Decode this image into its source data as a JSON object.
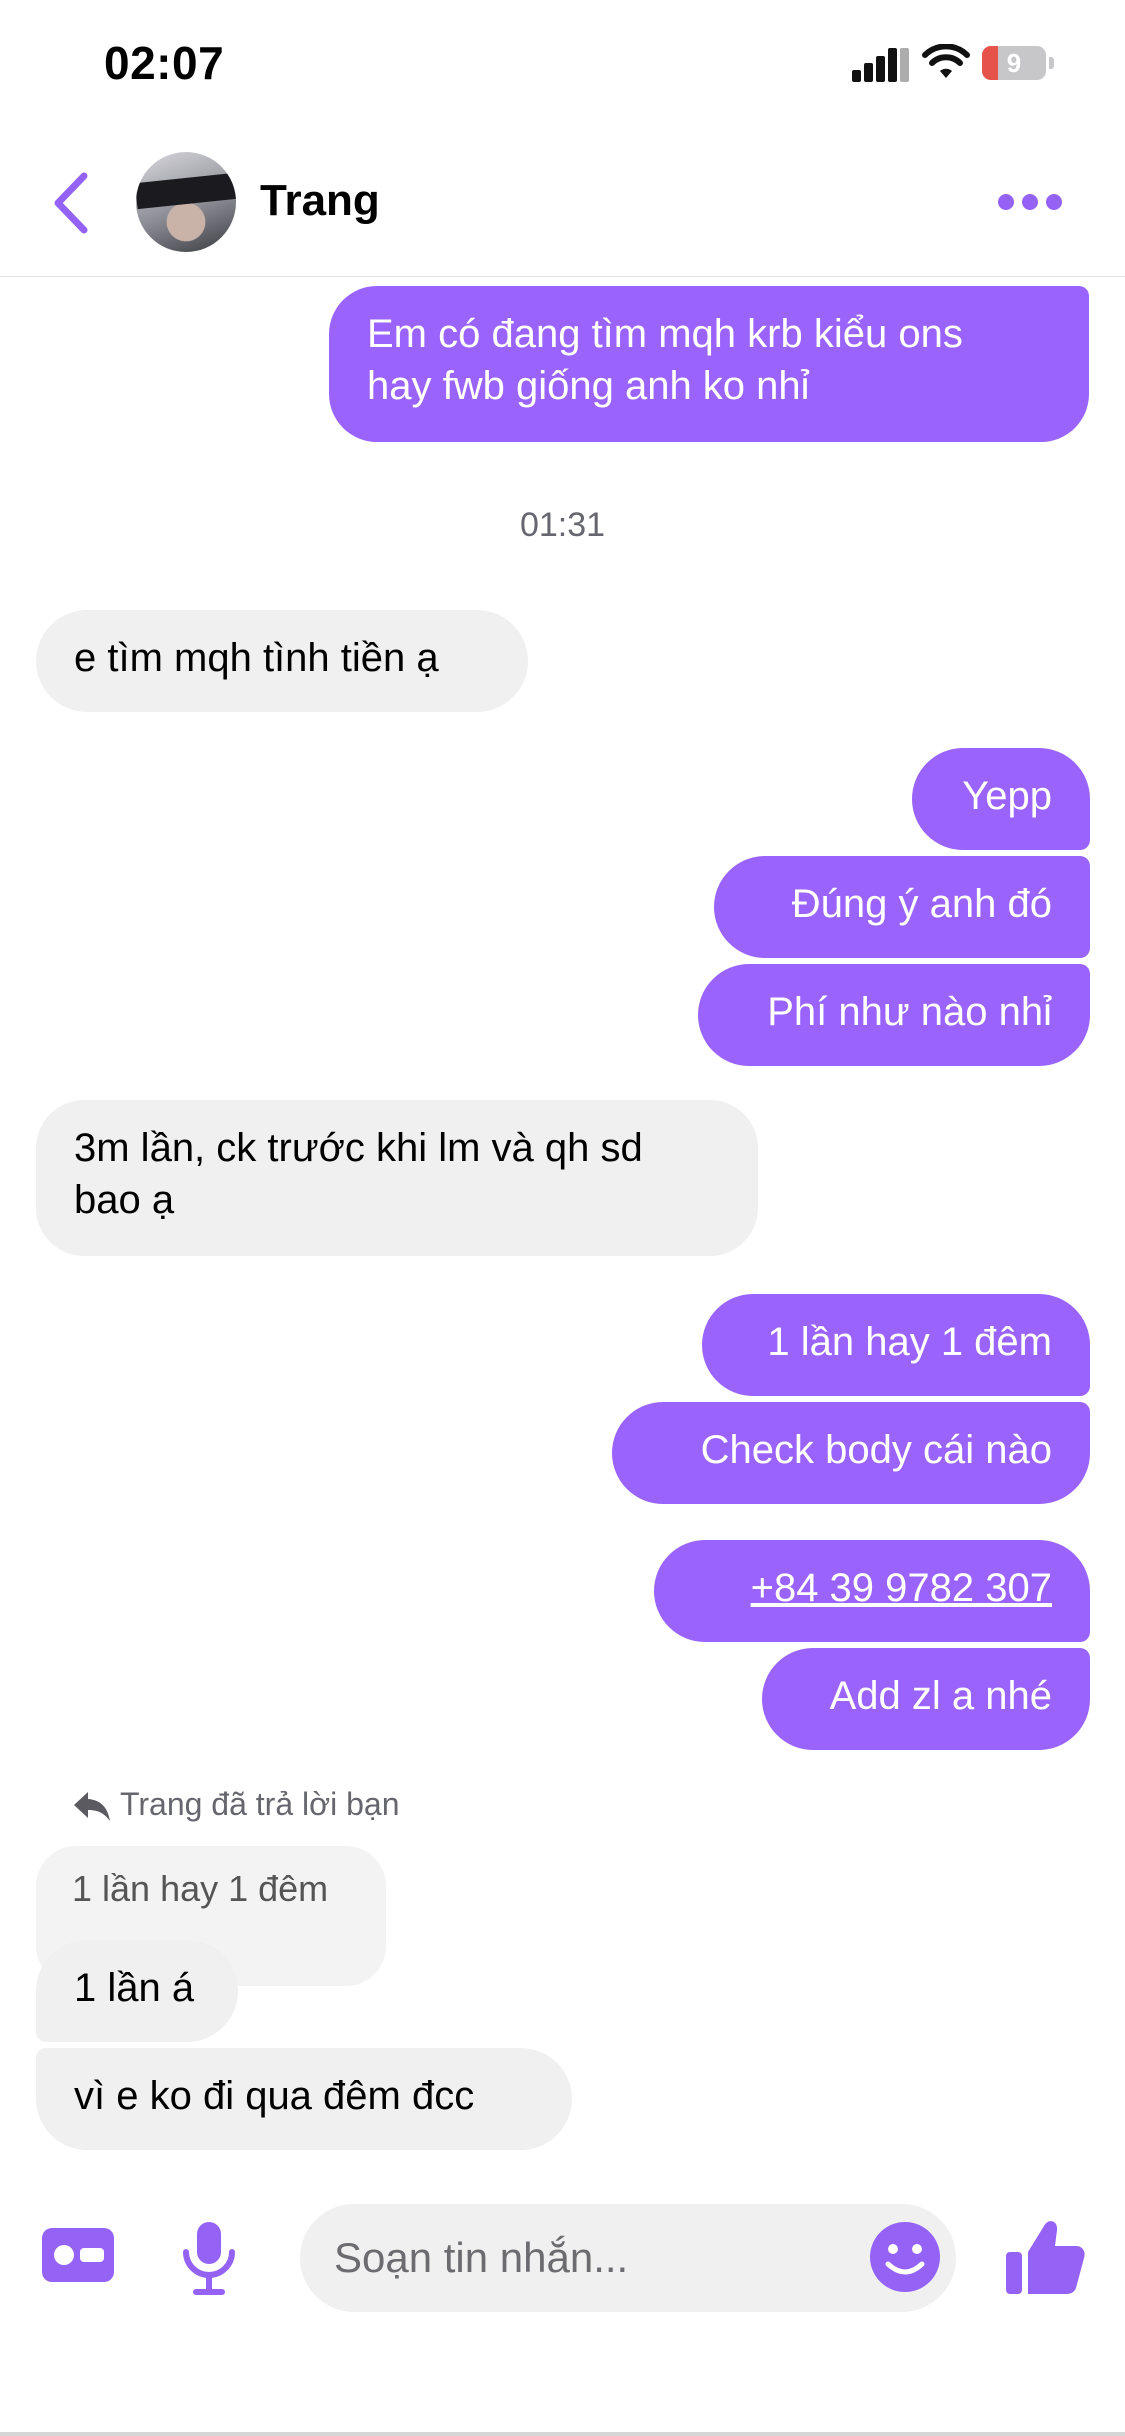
{
  "status_bar": {
    "time": "02:07",
    "battery_level": "9"
  },
  "header": {
    "contact_name": "Trang",
    "back_icon": "chevron-left-icon",
    "more_icon": "ellipsis-icon"
  },
  "colors": {
    "accent": "#9a63fb",
    "incoming_bubble": "#f0f0f0",
    "battery_low": "#e5534b"
  },
  "conversation": {
    "msg_1": "Em có đang tìm mqh krb kiểu ons\nhay fwb giống anh ko nhỉ",
    "timestamp": "01:31",
    "msg_2": "e tìm mqh tình tiền ạ",
    "msg_3": "Yepp",
    "msg_4": "Đúng ý anh đó",
    "msg_5": "Phí như nào nhỉ",
    "msg_6": "3m lần, ck trước khi lm và qh sd\nbao ạ",
    "msg_7": "1 lần hay 1 đêm",
    "msg_8": "Check body cái nào",
    "msg_9": "+84 39 9782 307",
    "msg_10": "Add zl a nhé",
    "reply_notice": "Trang đã trả lời bạn",
    "quoted_text": "1 lần hay 1 đêm",
    "msg_11": "1 lần á",
    "msg_12": "vì e ko đi qua đêm đcc"
  },
  "composer": {
    "placeholder": "Soạn tin nhắn...",
    "icons": [
      "contact-card-icon",
      "microphone-icon",
      "emoji-icon",
      "thumbs-up-icon"
    ]
  }
}
